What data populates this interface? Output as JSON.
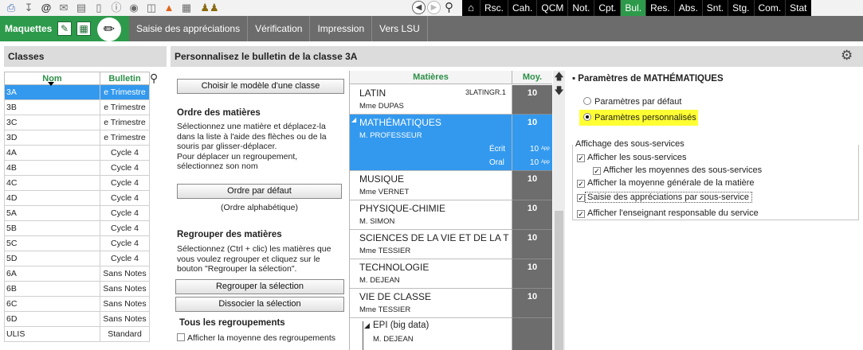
{
  "toolbar": {
    "icons": [
      "printer-icon",
      "download-icon",
      "at-icon",
      "mail-icon",
      "document-icon",
      "phone-icon",
      "info-icon",
      "chat-icon",
      "monitor-icon",
      "alarm-icon",
      "form-icon",
      "group-icon"
    ],
    "modules": [
      "Rsc.",
      "Cah.",
      "QCM",
      "Not.",
      "Cpt.",
      "Bul.",
      "Res.",
      "Abs.",
      "Snt.",
      "Stg.",
      "Com.",
      "Stat"
    ],
    "active_module": "Bul."
  },
  "greenbar": {
    "title": "Maquettes",
    "tabs": [
      "Saisie des appréciations",
      "Vérification",
      "Impression",
      "Vers LSU"
    ]
  },
  "classes": {
    "header": "Classes",
    "col_nom": "Nom",
    "col_bulletin": "Bulletin",
    "rows": [
      {
        "nom": "3A",
        "bulletin": "e Trimestre",
        "selected": true
      },
      {
        "nom": "3B",
        "bulletin": "e Trimestre"
      },
      {
        "nom": "3C",
        "bulletin": "e Trimestre"
      },
      {
        "nom": "3D",
        "bulletin": "e Trimestre"
      },
      {
        "nom": "4A",
        "bulletin": "Cycle 4"
      },
      {
        "nom": "4B",
        "bulletin": "Cycle 4"
      },
      {
        "nom": "4C",
        "bulletin": "Cycle 4"
      },
      {
        "nom": "4D",
        "bulletin": "Cycle 4"
      },
      {
        "nom": "5A",
        "bulletin": "Cycle 4"
      },
      {
        "nom": "5B",
        "bulletin": "Cycle 4"
      },
      {
        "nom": "5C",
        "bulletin": "Cycle 4"
      },
      {
        "nom": "5D",
        "bulletin": "Cycle 4"
      },
      {
        "nom": "6A",
        "bulletin": "Sans Notes"
      },
      {
        "nom": "6B",
        "bulletin": "Sans Notes"
      },
      {
        "nom": "6C",
        "bulletin": "Sans Notes"
      },
      {
        "nom": "6D",
        "bulletin": "Sans Notes"
      },
      {
        "nom": "ULIS",
        "bulletin": "Standard"
      }
    ]
  },
  "main": {
    "title": "Personnalisez le bulletin de la classe 3A",
    "choose_model_button": "Choisir le modèle d'une classe",
    "order_title": "Ordre des matières",
    "order_text": [
      "Sélectionnez une matière et déplacez-la",
      "dans la liste à l'aide des flèches ou de la",
      "souris par glisser-déplacer.",
      "Pour déplacer un regroupement,",
      "sélectionnez son nom"
    ],
    "default_order_button": "Ordre par défaut",
    "default_order_note": "(Ordre alphabétique)",
    "group_title": "Regrouper des matières",
    "group_text": [
      "Sélectionnez (Ctrl + clic) les matières que",
      "vous voulez regrouper et cliquez sur le",
      "bouton \"Regrouper la sélection\"."
    ],
    "group_button": "Regrouper la sélection",
    "ungroup_button": "Dissocier la sélection",
    "all_groups_title": "Tous les regroupements",
    "all_groups_checkbox": "Afficher la moyenne des regroupements"
  },
  "subjects": {
    "col_subjects": "Matières",
    "col_moy": "Moy.",
    "rows": [
      {
        "name": "LATIN",
        "teacher": "Mme DUPAS",
        "code": "3LATINGR.1",
        "moy": "10"
      },
      {
        "name": "MATHÉMATIQUES",
        "teacher": "M. PROFESSEUR",
        "moy": "10",
        "selected": true,
        "sub_services": [
          {
            "label": "Écrit",
            "moy": "10",
            "app": "App"
          },
          {
            "label": "Oral",
            "moy": "10",
            "app": "App"
          }
        ]
      },
      {
        "name": "MUSIQUE",
        "teacher": "Mme VERNET",
        "moy": "10"
      },
      {
        "name": "PHYSIQUE-CHIMIE",
        "teacher": "M. SIMON",
        "moy": "10"
      },
      {
        "name": "SCIENCES DE LA VIE ET DE LA TE",
        "teacher": "Mme TESSIER",
        "moy": "10"
      },
      {
        "name": "TECHNOLOGIE",
        "teacher": "M. DEJEAN",
        "moy": "10"
      },
      {
        "name": "VIE DE CLASSE",
        "teacher": "Mme TESSIER",
        "moy": "10"
      }
    ],
    "group": {
      "name": "EPI (big data)",
      "teacher": "M. DEJEAN"
    }
  },
  "params": {
    "title": "Paramètres de MATHÉMATIQUES",
    "radio_default": "Paramètres par défaut",
    "radio_custom": "Paramètres personnalisés",
    "fieldset_legend": "Affichage des sous-services",
    "options": [
      {
        "label": "Afficher les sous-services",
        "checked": true
      },
      {
        "label": "Afficher les moyennes des sous-services",
        "checked": true
      },
      {
        "label": "Afficher la moyenne générale de la matière",
        "checked": true
      },
      {
        "label": "Saisie des appréciations par sous-service",
        "checked": true
      },
      {
        "label": "Afficher l'enseignant responsable du service",
        "checked": true
      }
    ]
  }
}
